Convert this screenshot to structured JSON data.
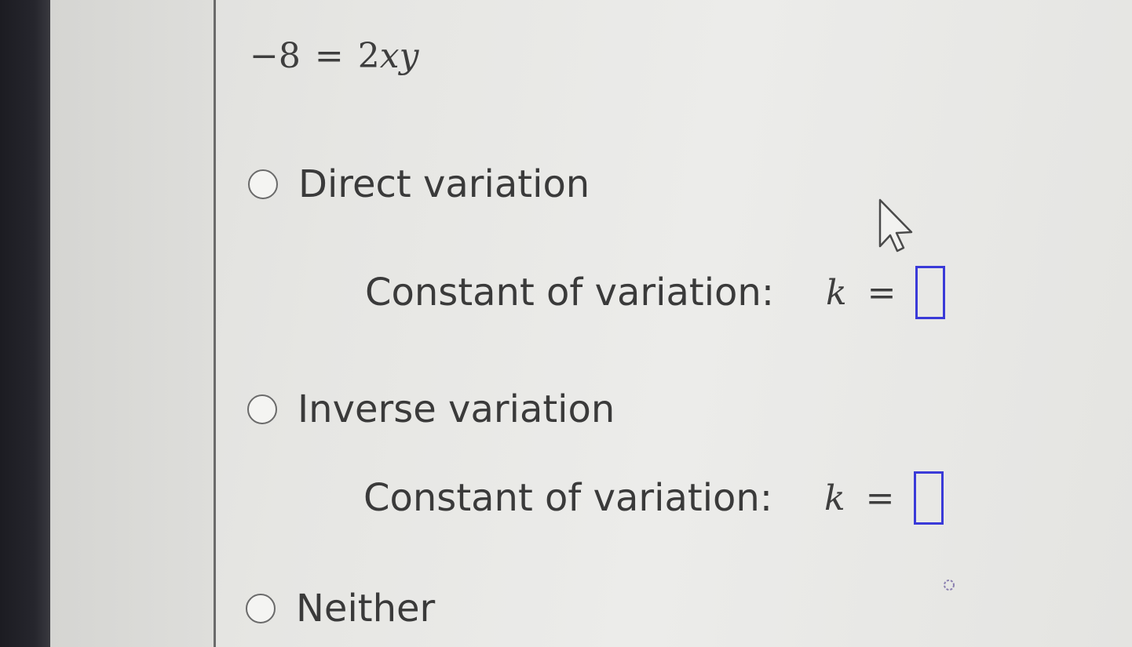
{
  "equation": {
    "left_number": "−8",
    "equals": "=",
    "coefficient": "2",
    "var1": "x",
    "var2": "y"
  },
  "options": [
    {
      "label": "Direct variation",
      "constant_label": "Constant of variation:",
      "k_symbol": "k",
      "equals": "=",
      "k_value": ""
    },
    {
      "label": "Inverse variation",
      "constant_label": "Constant of variation:",
      "k_symbol": "k",
      "equals": "=",
      "k_value": ""
    },
    {
      "label": "Neither"
    }
  ],
  "colors": {
    "answer_box_border": "#3a3ad8",
    "text": "#3a3a3a",
    "divider": "#6a6a6a"
  },
  "icons": [
    "mouse-pointer-icon",
    "radio-unselected-icon"
  ]
}
